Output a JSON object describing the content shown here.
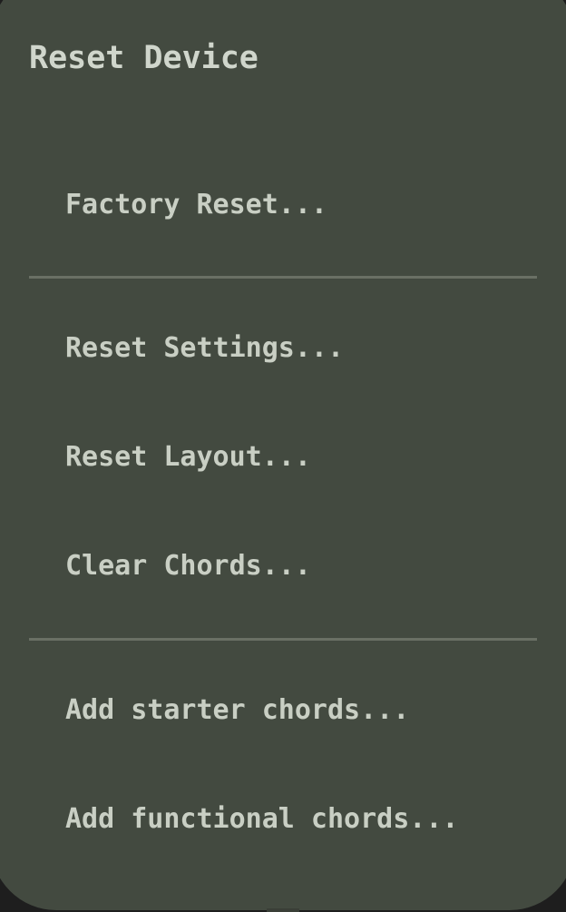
{
  "dialog": {
    "title": "Reset Device",
    "groups": [
      {
        "items": [
          {
            "label": "Factory Reset..."
          }
        ]
      },
      {
        "items": [
          {
            "label": "Reset Settings..."
          },
          {
            "label": "Reset Layout..."
          },
          {
            "label": "Clear Chords..."
          }
        ]
      },
      {
        "items": [
          {
            "label": "Add starter chords..."
          },
          {
            "label": "Add functional chords..."
          }
        ]
      }
    ]
  }
}
